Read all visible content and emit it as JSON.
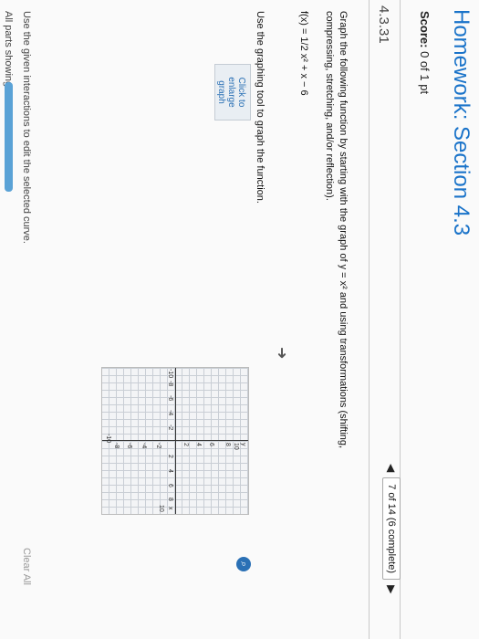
{
  "header": {
    "title": "Homework: Section 4.3",
    "score_label": "Score:",
    "score_value": "0 of 1 pt"
  },
  "question": {
    "number": "4.3.31",
    "pager": "7 of 14 (6 complete)",
    "prompt": "Graph the following function by starting with the graph of y = x² and using transformations (shifting, compressing, stretching, and/or reflection).",
    "function_text": "f(x) = 1/2 x² + x − 6",
    "tool_instruction": "Use the graphing tool to graph the function.",
    "thumb_label": "Click to enlarge graph"
  },
  "graph": {
    "x_label": "x",
    "y_label": "y",
    "x_ticks": [
      "-10",
      "-8",
      "-6",
      "-4",
      "-2",
      "2",
      "4",
      "6",
      "8",
      "10"
    ],
    "y_ticks": [
      "10",
      "8",
      "6",
      "4",
      "2",
      "-2",
      "-4",
      "-6",
      "-8",
      "-10"
    ]
  },
  "footer": {
    "instruction": "Use the given interactions to edit the selected curve.",
    "parts": "All parts showing",
    "clear_all": "Clear All",
    "progress": 1.0
  },
  "icons": {
    "prev": "triangle-left-icon",
    "next": "triangle-right-icon",
    "zoom": "magnifier-icon"
  }
}
